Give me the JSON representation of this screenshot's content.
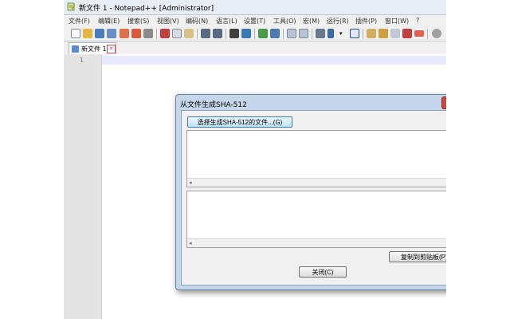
{
  "window": {
    "title": "新文件 1 - Notepad++ [Administrator]"
  },
  "menu": [
    "文件(F)",
    "编辑(E)",
    "搜索(S)",
    "视图(V)",
    "编码(N)",
    "语言(L)",
    "设置(T)",
    "工具(O)",
    "宏(M)",
    "运行(R)",
    "插件(P)",
    "窗口(W)",
    "?"
  ],
  "toolbar": {
    "icons": [
      "new-file-icon",
      "open-file-icon",
      "save-icon",
      "save-all-icon",
      "close-icon",
      "close-all-icon",
      "print-icon",
      "cut-icon",
      "copy-icon",
      "paste-icon",
      "undo-icon",
      "redo-icon",
      "find-icon",
      "replace-icon",
      "zoom-in-icon",
      "zoom-out-icon",
      "sync-v-icon",
      "sync-h-icon",
      "wrap-icon",
      "show-all-icon",
      "indent-guide-icon",
      "document-map-icon",
      "function-list-icon",
      "folder-workspace-icon",
      "monitor-icon",
      "record-macro-icon",
      "stop-record-icon"
    ]
  },
  "tabs": [
    {
      "label": "新文件 1"
    }
  ],
  "editor": {
    "line_number": "1"
  },
  "dialog": {
    "title": "从文件生成SHA-512",
    "select_button": "选择生成SHA-512的文件...(G)",
    "copy_button": "复制到剪贴板(P)",
    "close_button": "关闭(C)"
  },
  "colors": {
    "app_frame": "#d6dfeb",
    "dialog_frame": "#c6d6ea",
    "current_line": "#e8e8ff",
    "gutter": "#e4e4e4"
  }
}
